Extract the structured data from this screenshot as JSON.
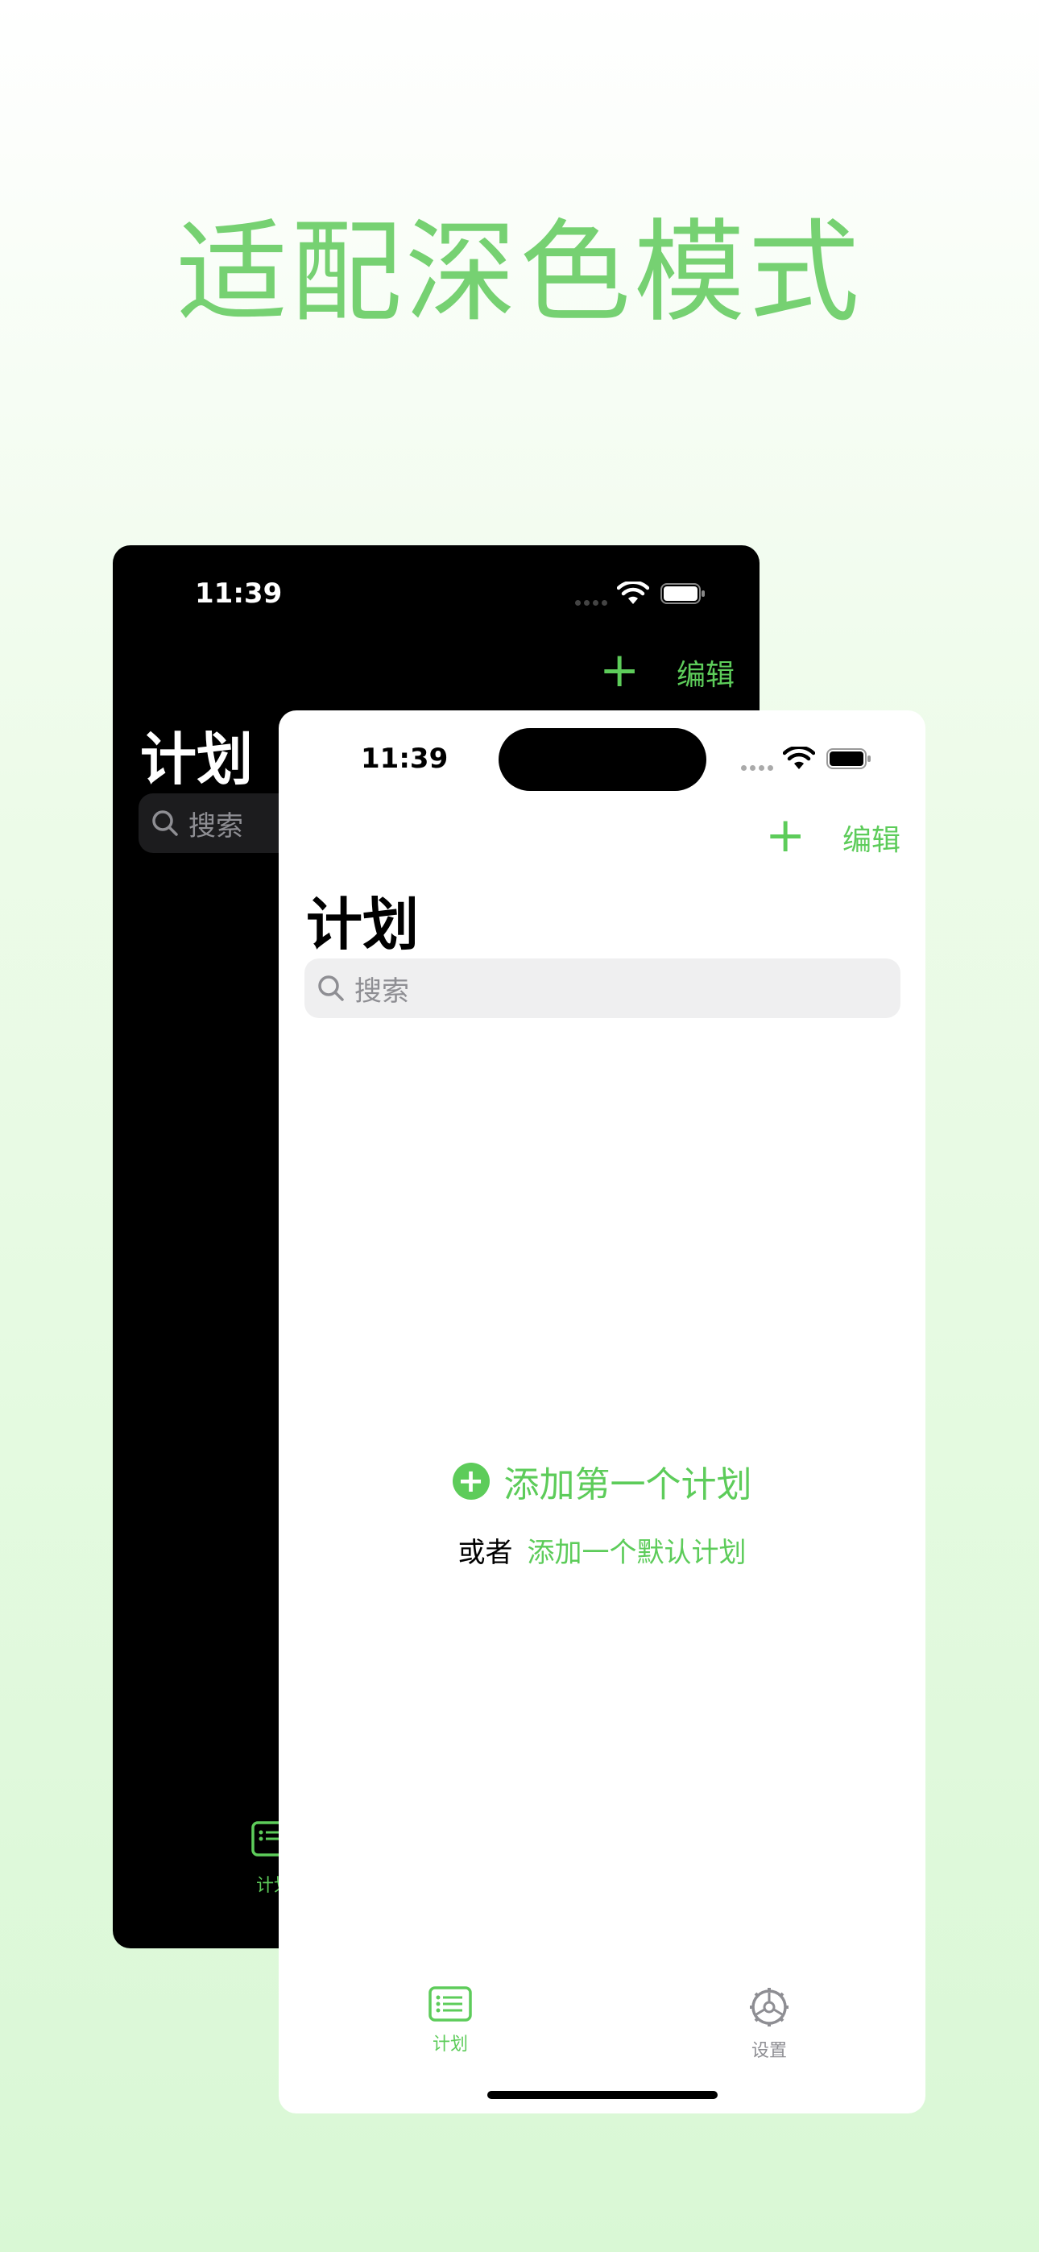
{
  "headline": "适配深色模式",
  "dark_phone": {
    "status_time": "11:39",
    "nav": {
      "add_label": "+",
      "edit_label": "编辑"
    },
    "title": "计划",
    "search_placeholder": "搜索",
    "tab_plan_label": "计划"
  },
  "light_phone": {
    "status_time": "11:39",
    "nav": {
      "add_label": "+",
      "edit_label": "编辑"
    },
    "title": "计划",
    "search_placeholder": "搜索",
    "empty_state": {
      "add_icon": "+",
      "add_label": "添加第一个计划",
      "or_label": "或者",
      "default_link": "添加一个默认计划"
    },
    "tabs": [
      {
        "label": "计划",
        "icon": "list-icon",
        "active": true
      },
      {
        "label": "设置",
        "icon": "settings-gear-icon",
        "active": false
      }
    ]
  },
  "colors": {
    "accent": "#5dcc5a",
    "headline": "#76d172"
  }
}
